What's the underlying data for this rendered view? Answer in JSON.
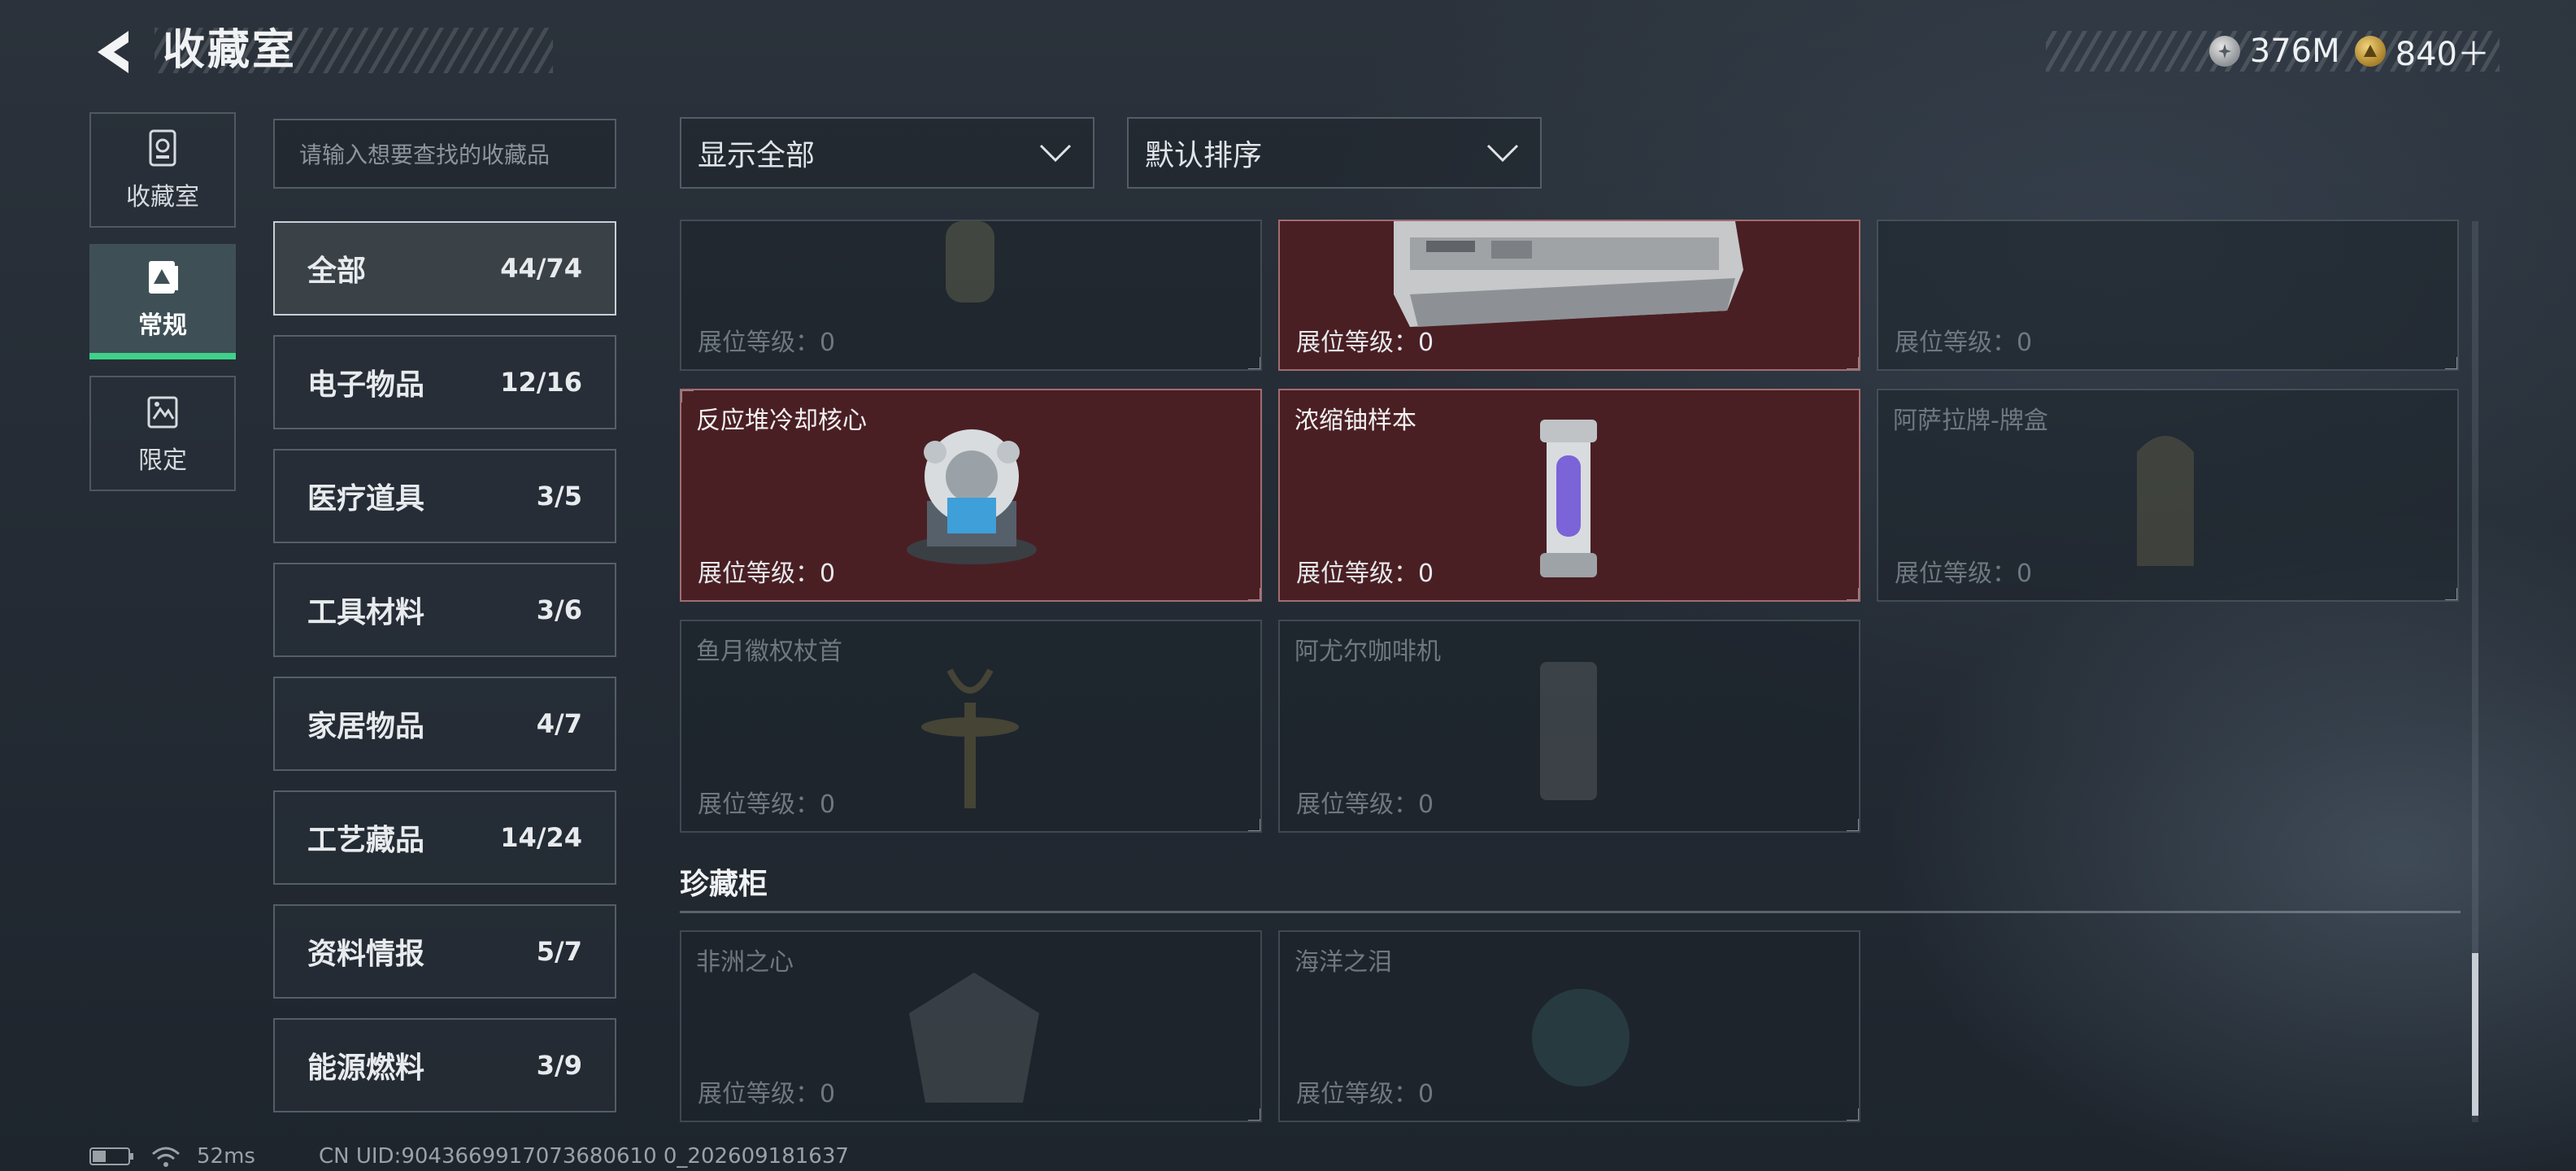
{
  "header": {
    "title": "收藏室",
    "currency": [
      {
        "icon": "silver-coin-icon",
        "value": "376M"
      },
      {
        "icon": "gold-coin-icon",
        "value": "840＋"
      }
    ]
  },
  "rail": [
    {
      "label": "收藏室",
      "icon": "collection-room-icon",
      "active": false
    },
    {
      "label": "常规",
      "icon": "regular-card-icon",
      "active": true
    },
    {
      "label": "限定",
      "icon": "limited-card-icon",
      "active": false
    }
  ],
  "search": {
    "placeholder": "请输入想要查找的收藏品"
  },
  "categories": [
    {
      "name": "全部",
      "count": "44/74"
    },
    {
      "name": "电子物品",
      "count": "12/16"
    },
    {
      "name": "医疗道具",
      "count": "3/5"
    },
    {
      "name": "工具材料",
      "count": "3/6"
    },
    {
      "name": "家居物品",
      "count": "4/7"
    },
    {
      "name": "工艺藏品",
      "count": "14/24"
    },
    {
      "name": "资料情报",
      "count": "5/7"
    },
    {
      "name": "能源燃料",
      "count": "3/9"
    }
  ],
  "filters": {
    "show": "显示全部",
    "sort": "默认排序"
  },
  "items": [
    {
      "name": "",
      "level": "展位等级：0",
      "owned": false
    },
    {
      "name": "",
      "level": "展位等级：0",
      "owned": true
    },
    {
      "name": "",
      "level": "展位等级：0",
      "owned": false
    },
    {
      "name": "反应堆冷却核心",
      "level": "展位等级：0",
      "owned": true
    },
    {
      "name": "浓缩铀样本",
      "level": "展位等级：0",
      "owned": true
    },
    {
      "name": "阿萨拉牌-牌盒",
      "level": "展位等级：0",
      "owned": false
    },
    {
      "name": "鱼月徽权杖首",
      "level": "展位等级：0",
      "owned": false
    },
    {
      "name": "阿尤尔咖啡机",
      "level": "展位等级：0",
      "owned": false
    }
  ],
  "section": {
    "title": "珍藏柜"
  },
  "treasures": [
    {
      "name": "非洲之心",
      "level": "展位等级：0",
      "owned": false
    },
    {
      "name": "海洋之泪",
      "level": "展位等级：0",
      "owned": false
    }
  ],
  "status": {
    "ping": "52ms",
    "uid": "CN UID:9043669917073680610 0_202609181637"
  }
}
